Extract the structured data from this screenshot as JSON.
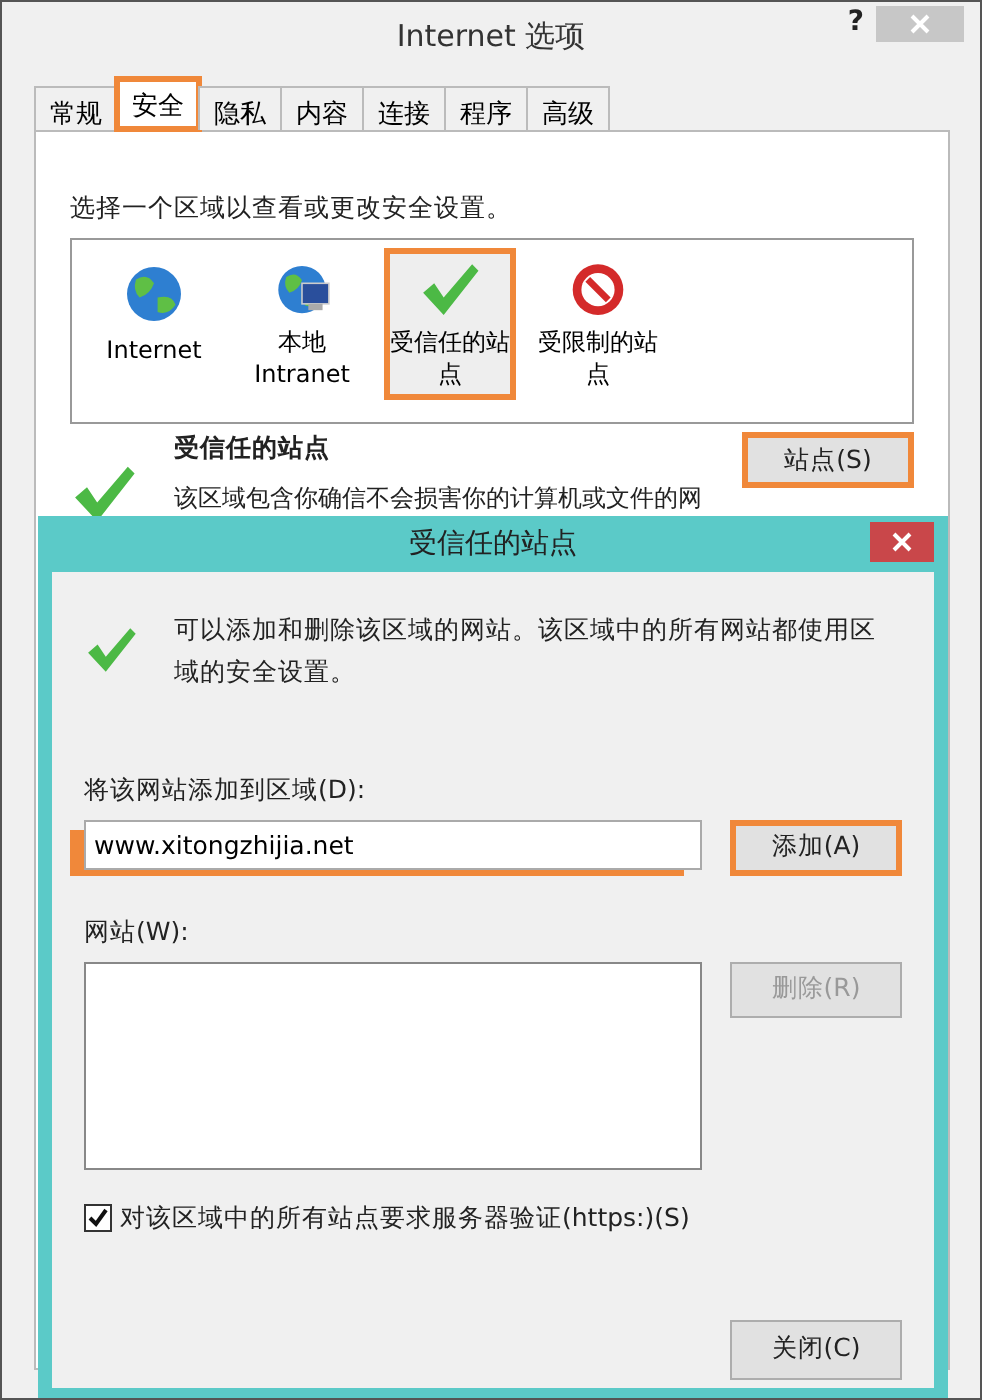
{
  "window": {
    "title": "Internet 选项",
    "help": "?"
  },
  "tabs": [
    {
      "label": "常规",
      "selected": false,
      "highlighted": false
    },
    {
      "label": "安全",
      "selected": true,
      "highlighted": true
    },
    {
      "label": "隐私",
      "selected": false,
      "highlighted": false
    },
    {
      "label": "内容",
      "selected": false,
      "highlighted": false
    },
    {
      "label": "连接",
      "selected": false,
      "highlighted": false
    },
    {
      "label": "程序",
      "selected": false,
      "highlighted": false
    },
    {
      "label": "高级",
      "selected": false,
      "highlighted": false
    }
  ],
  "zone_prompt": "选择一个区域以查看或更改安全设置。",
  "zones": [
    {
      "label": "Internet",
      "kind": "globe",
      "selected": false,
      "highlighted": false
    },
    {
      "label": "本地 Intranet",
      "kind": "intranet",
      "selected": false,
      "highlighted": false
    },
    {
      "label": "受信任的站点",
      "kind": "trusted",
      "selected": true,
      "highlighted": true
    },
    {
      "label": "受限制的站点",
      "kind": "restricted",
      "selected": false,
      "highlighted": false
    }
  ],
  "zone_info": {
    "title": "受信任的站点",
    "description": "该区域包含你确信不会损害你的计算机或文件的网",
    "button": {
      "label": "站点(S)",
      "highlighted": true
    }
  },
  "dialog": {
    "title": "受信任的站点",
    "message": "可以添加和删除该区域的网站。该区域中的所有网站都使用区域的安全设置。",
    "add_label": "将该网站添加到区域(D):",
    "url_value": "www.xitongzhijia.net",
    "url_underlined": true,
    "add_button": {
      "label": "添加(A)",
      "highlighted": true,
      "disabled": false
    },
    "sites_label": "网站(W):",
    "remove_button": {
      "label": "删除(R)",
      "highlighted": false,
      "disabled": true
    },
    "https_check": {
      "label": "对该区域中的所有站点要求服务器验证(https:)(S)",
      "checked": true
    },
    "close_button": {
      "label": "关闭(C)",
      "highlighted": false,
      "disabled": false
    }
  }
}
